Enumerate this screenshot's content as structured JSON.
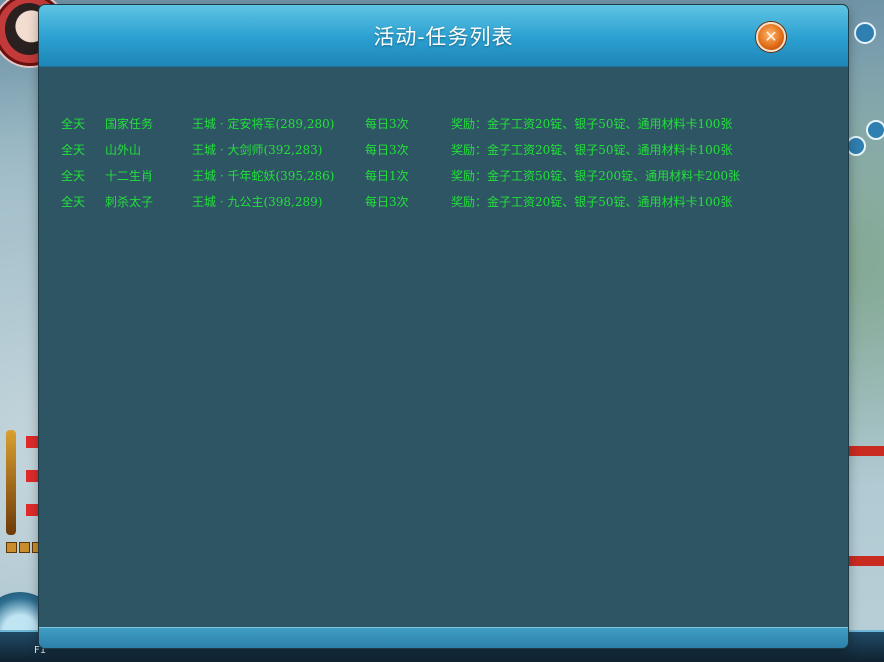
{
  "dialog": {
    "title": "活动-任务列表",
    "close_icon": "close-icon"
  },
  "tasks": [
    {
      "time": "全天",
      "name": "国家任务",
      "location": "王城 · 定安将军(289,280)",
      "frequency": "每日3次",
      "reward": "奖励：金子工资20锭、银子50锭、通用材料卡100张"
    },
    {
      "time": "全天",
      "name": "山外山",
      "location": "王城 · 大剑师(392,283)",
      "frequency": "每日3次",
      "reward": "奖励：金子工资20锭、银子50锭、通用材料卡100张"
    },
    {
      "time": "全天",
      "name": "十二生肖",
      "location": "王城 · 千年蛇妖(395,286)",
      "frequency": "每日1次",
      "reward": "奖励：金子工资50锭、银子200锭、通用材料卡200张"
    },
    {
      "time": "全天",
      "name": "刺杀太子",
      "location": "王城 · 九公主(398,289)",
      "frequency": "每日3次",
      "reward": "奖励：金子工资20锭、银子50锭、通用材料卡100张"
    }
  ],
  "hud": {
    "bottom_label": "F1"
  },
  "colors": {
    "task_text": "#22e03a",
    "dialog_bg": "#2e5563",
    "header": "#2a9fd0",
    "close_button": "#e06a14"
  }
}
